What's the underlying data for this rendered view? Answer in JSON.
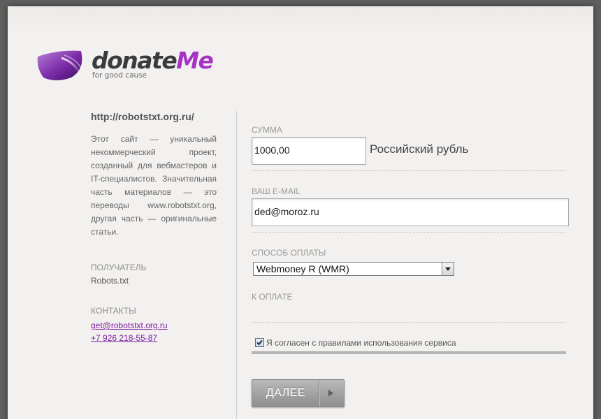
{
  "logo": {
    "word_part1": "donate",
    "word_part2": "Me",
    "tagline": "for good cause"
  },
  "site": {
    "url": "http://robotstxt.org.ru/",
    "description": "Этот сайт — уникальный некоммерческий проект, созданный для вебмастеров и IT-специалистов. Значительная часть материалов — это переводы www.robotstxt.org, другая часть — оригинальные статьи."
  },
  "recipient": {
    "label": "ПОЛУЧАТЕЛЬ",
    "value": "Robots.txt"
  },
  "contacts": {
    "label": "КОНТАКТЫ",
    "email": "get@robotstxt.org.ru",
    "phone": "+7 926 218-55-87"
  },
  "form": {
    "amount_label": "СУММА",
    "amount_value": "1000,00",
    "currency": "Российский рубль",
    "email_label": "ВАШ E-MAIL",
    "email_value": "ded@moroz.ru",
    "method_label": "СПОСОБ ОПЛАТЫ",
    "method_value": "Webmoney R (WMR)",
    "topay_label": "К ОПЛАТЕ",
    "agree_checked": true,
    "agree_label": "Я согласен с правилами использования сервиса",
    "submit_label": "ДАЛЕЕ"
  },
  "colors": {
    "accent": "#a533c4",
    "link": "#7b1fa2",
    "background": "#f3f1ef"
  }
}
